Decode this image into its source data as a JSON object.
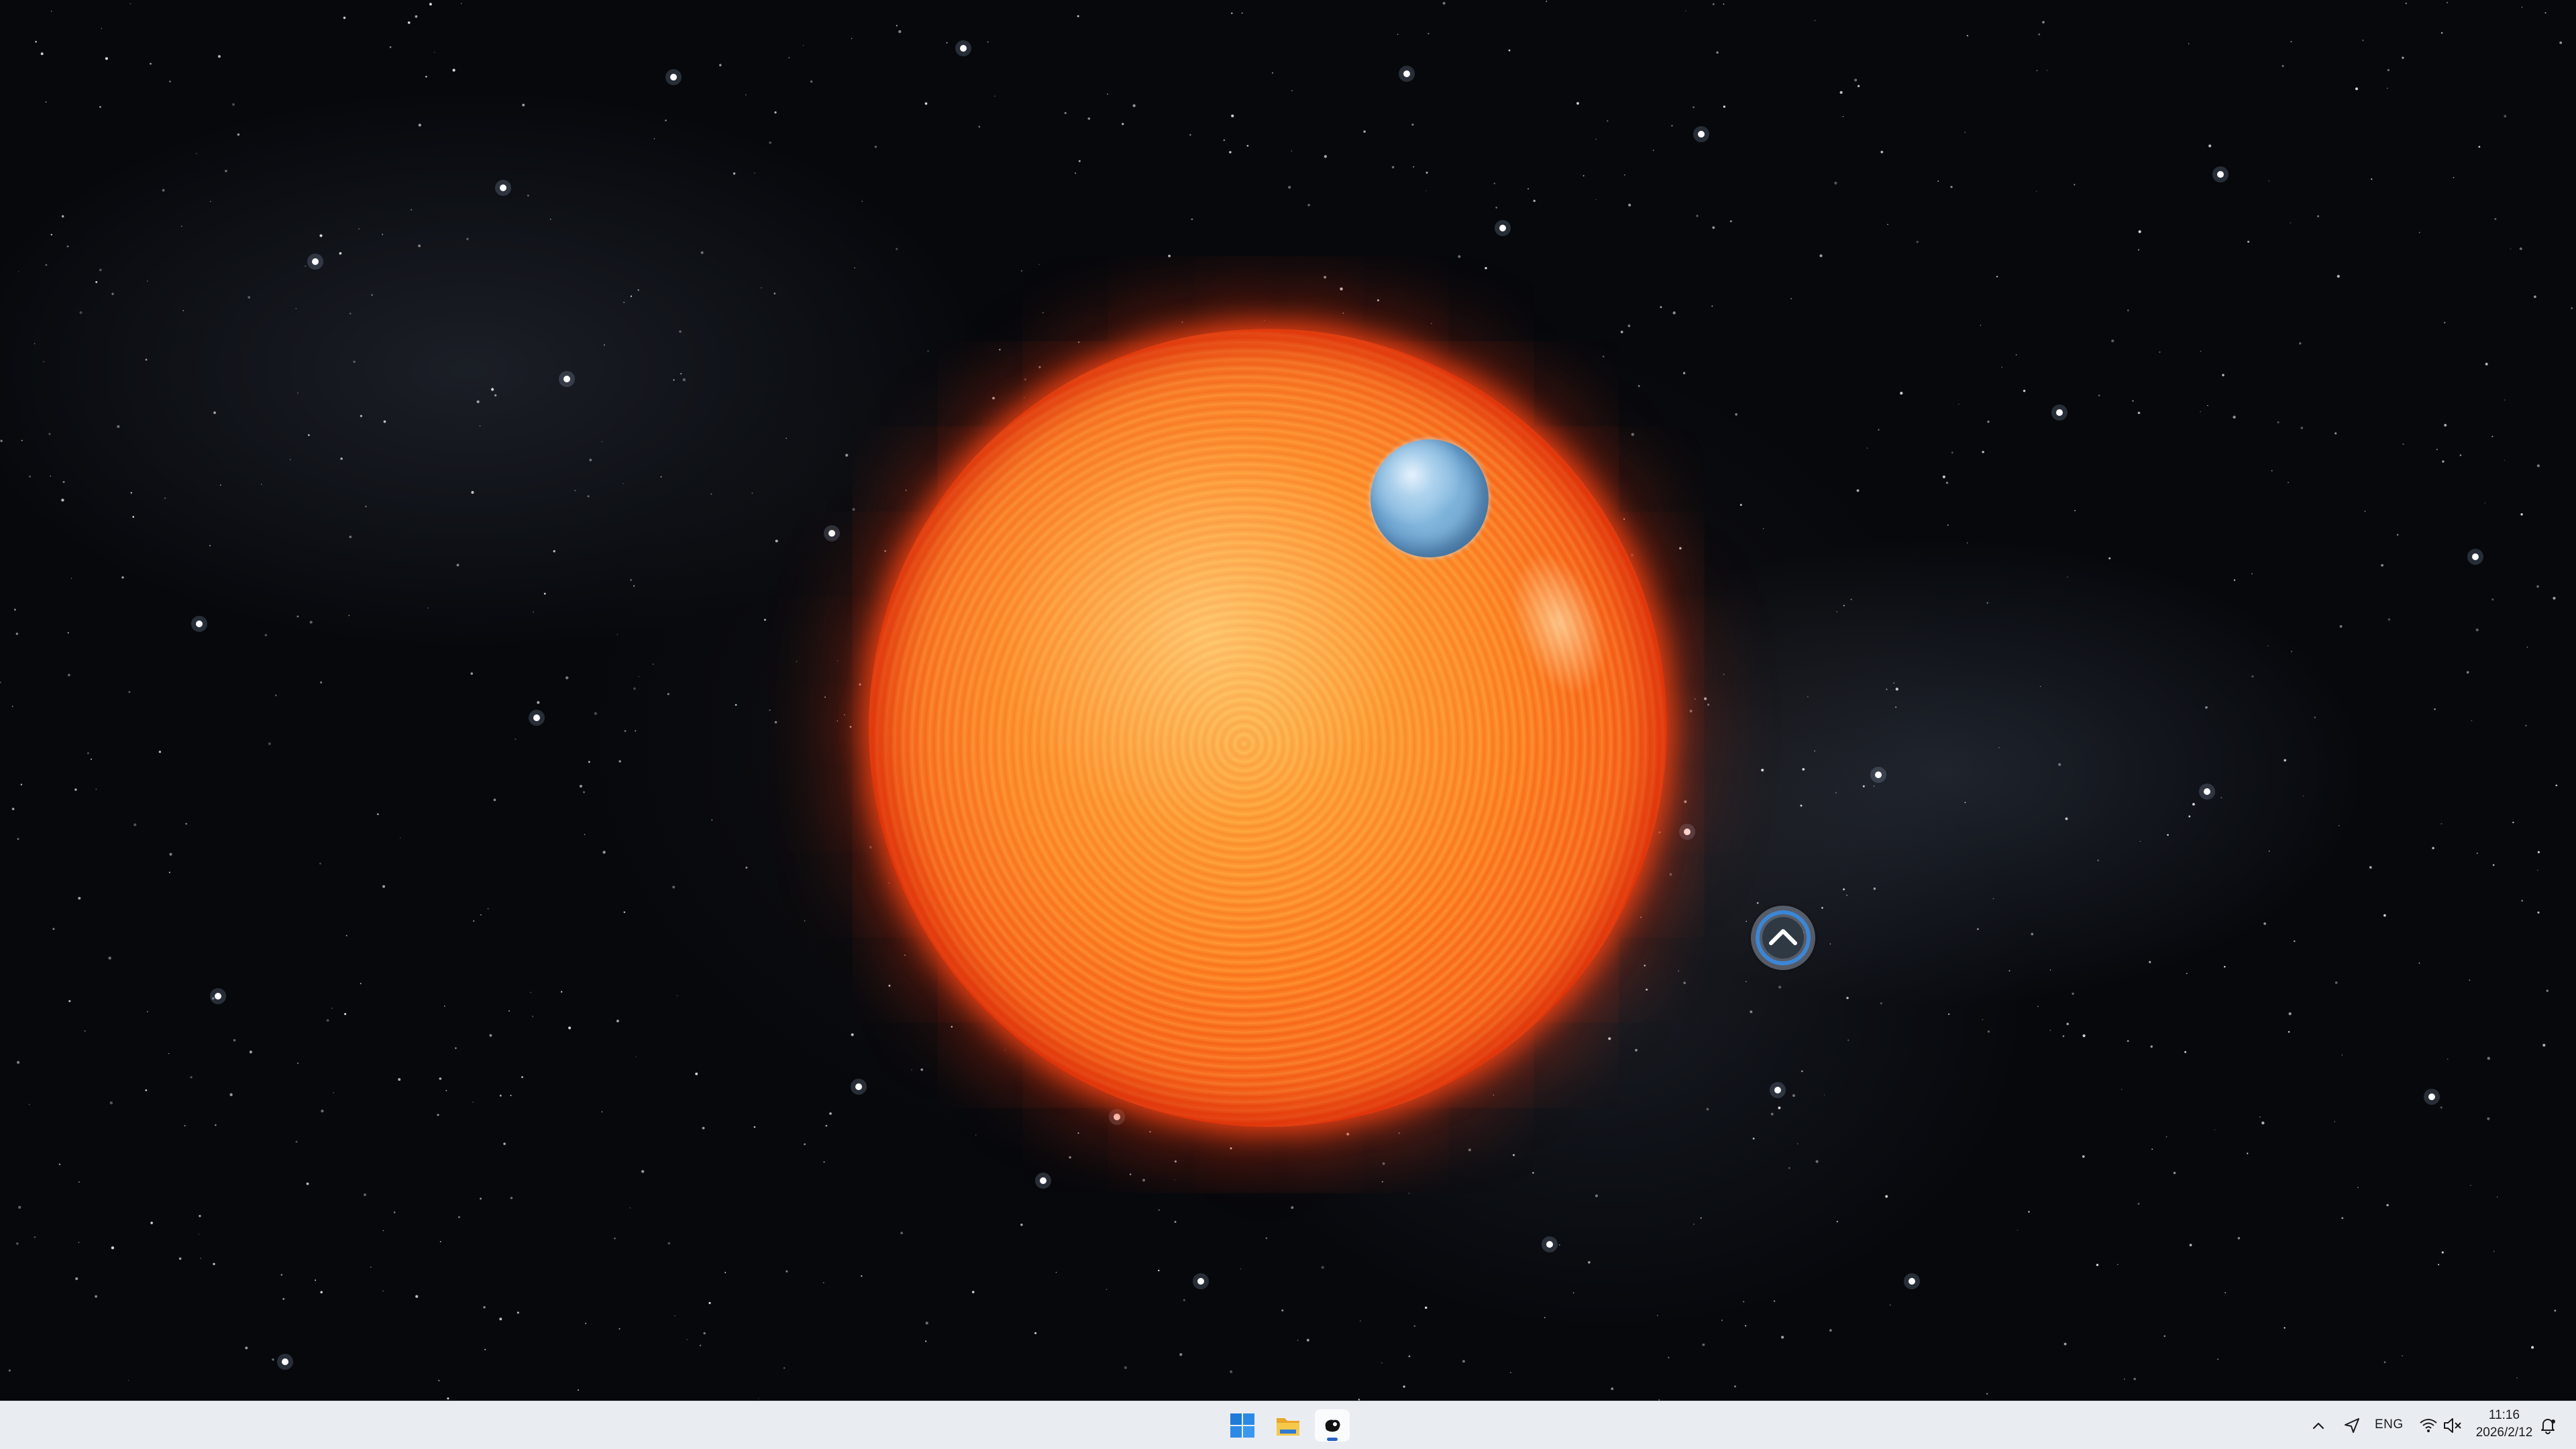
{
  "desktop": {
    "wallpaper": "space-scene-red-sun",
    "overlay_button": {
      "icon": "chevron-up-icon"
    }
  },
  "taskbar": {
    "pinned": [
      {
        "name": "start",
        "icon": "windows-logo-icon",
        "active": false
      },
      {
        "name": "file-explorer",
        "icon": "folder-icon",
        "active": false
      },
      {
        "name": "running-app",
        "icon": "app-blob-icon",
        "active": true
      }
    ],
    "tray": {
      "overflow_icon": "chevron-up-icon",
      "location_icon": "location-arrow-icon",
      "language": "ENG",
      "wifi_icon": "wifi-icon",
      "volume_icon": "volume-muted-icon",
      "time": "11:16",
      "date": "2026/2/12",
      "notification_icon": "notification-bell-icon"
    }
  },
  "colors": {
    "taskbar_bg": "#e9edf2",
    "accent": "#2a63c4",
    "sun": "#ff7a1c",
    "planet": "#9fcbea"
  }
}
